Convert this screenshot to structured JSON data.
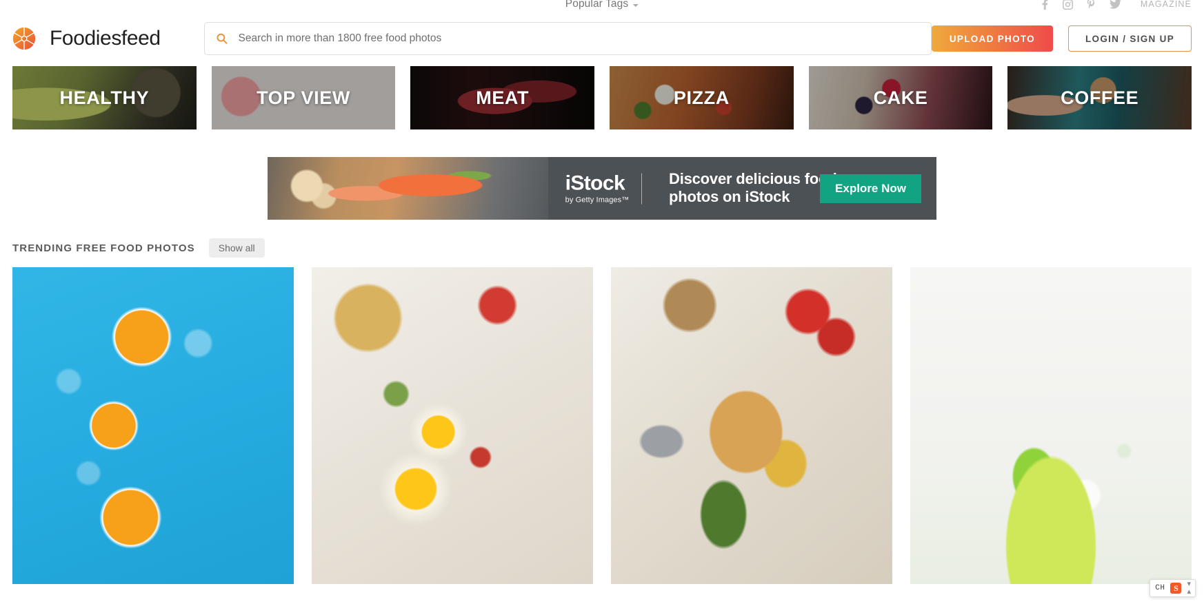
{
  "topbar": {
    "popular_tags_label": "Popular Tags",
    "caret_icon": "chevron-down-icon",
    "social": [
      {
        "name": "facebook-icon",
        "label": "Facebook"
      },
      {
        "name": "instagram-icon",
        "label": "Instagram"
      },
      {
        "name": "pinterest-icon",
        "label": "Pinterest"
      },
      {
        "name": "twitter-icon",
        "label": "Twitter"
      }
    ],
    "magazine_label": "MAGAZINE"
  },
  "header": {
    "logo_icon": "aperture-logo-icon",
    "brand_name": "Foodiesfeed",
    "search": {
      "icon": "search-icon",
      "placeholder": "Search in more than 1800 free food photos",
      "value": ""
    },
    "upload_label": "UPLOAD PHOTO",
    "login_label": "LOGIN / SIGN UP"
  },
  "categories": [
    {
      "label": "HEALTHY",
      "bg": "bg-healthy"
    },
    {
      "label": "TOP VIEW",
      "bg": "bg-topview"
    },
    {
      "label": "MEAT",
      "bg": "bg-meat"
    },
    {
      "label": "PIZZA",
      "bg": "bg-pizza"
    },
    {
      "label": "CAKE",
      "bg": "bg-cake"
    },
    {
      "label": "COFFEE",
      "bg": "bg-coffee"
    }
  ],
  "ad": {
    "brand": "iStock",
    "brand_sub": "by Getty Images™",
    "headline": "Discover delicious food photos on iStock",
    "cta_label": "Explore Now",
    "cta_color": "#12a482"
  },
  "section": {
    "title": "TRENDING FREE FOOD PHOTOS",
    "show_all_label": "Show all"
  },
  "photos": [
    {
      "alt": "Orange slices on blue background with ice cubes",
      "bg": "ph-orange"
    },
    {
      "alt": "Avocado toast with fried eggs and tomatoes",
      "bg": "ph-toast"
    },
    {
      "alt": "Burger flatlay on wooden board with vegetables",
      "bg": "ph-burger"
    },
    {
      "alt": "Lime splashing into a green drink",
      "bg": "ph-lime"
    }
  ],
  "float_widget": {
    "lang": "CH",
    "logo_letter": "S",
    "grip_icon": "drag-handle-icon"
  },
  "colors": {
    "accent_orange": "#f0903f",
    "accent_red": "#ef4b4b",
    "teal": "#12a482"
  }
}
